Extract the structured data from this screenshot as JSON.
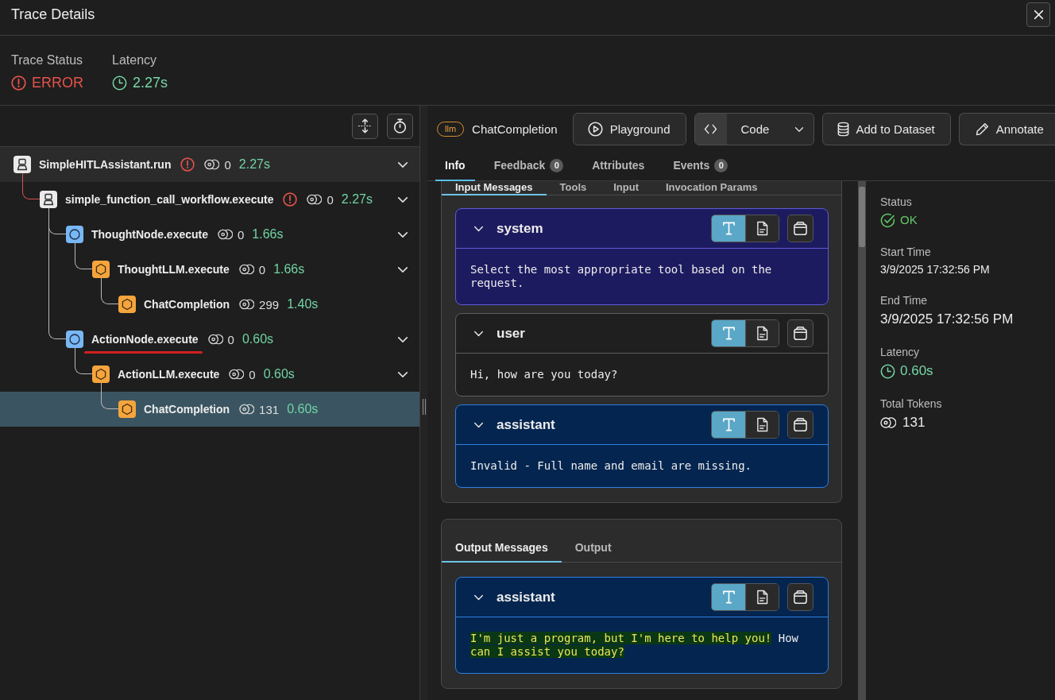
{
  "dialog": {
    "title": "Trace Details"
  },
  "summary": [
    {
      "label": "Trace Status",
      "value": "ERROR",
      "kind": "status_error"
    },
    {
      "label": "Latency",
      "value": "2.27s",
      "kind": "latency"
    }
  ],
  "tree": {
    "nodes": [
      {
        "name": "SimpleHITLAssistant.run",
        "kind": "agent",
        "error": true,
        "tokens": "0",
        "latency": "2.27s",
        "expanded": true,
        "selected": false,
        "underlined": false,
        "children": [
          {
            "name": "simple_function_call_workflow.execute",
            "kind": "agent",
            "error": true,
            "tokens": "0",
            "latency": "2.27s",
            "expanded": true,
            "selected": false,
            "underlined": false,
            "children": [
              {
                "name": "ThoughtNode.execute",
                "kind": "node",
                "error": false,
                "tokens": "0",
                "latency": "1.66s",
                "expanded": true,
                "selected": false,
                "underlined": false,
                "children": [
                  {
                    "name": "ThoughtLLM.execute",
                    "kind": "llm",
                    "error": false,
                    "tokens": "0",
                    "latency": "1.66s",
                    "expanded": true,
                    "selected": false,
                    "underlined": false,
                    "children": [
                      {
                        "name": "ChatCompletion",
                        "kind": "llm",
                        "error": false,
                        "tokens": "299",
                        "latency": "1.40s",
                        "expanded": false,
                        "selected": false,
                        "underlined": false
                      }
                    ]
                  }
                ]
              },
              {
                "name": "ActionNode.execute",
                "kind": "node",
                "error": false,
                "tokens": "0",
                "latency": "0.60s",
                "expanded": true,
                "selected": false,
                "underlined": true,
                "children": [
                  {
                    "name": "ActionLLM.execute",
                    "kind": "llm",
                    "error": false,
                    "tokens": "0",
                    "latency": "0.60s",
                    "expanded": true,
                    "selected": false,
                    "underlined": false,
                    "children": [
                      {
                        "name": "ChatCompletion",
                        "kind": "llm",
                        "error": false,
                        "tokens": "131",
                        "latency": "0.60s",
                        "expanded": false,
                        "selected": true,
                        "underlined": false
                      }
                    ]
                  }
                ]
              }
            ]
          }
        ]
      }
    ]
  },
  "span": {
    "badge": "llm",
    "name": "ChatCompletion",
    "actions": [
      {
        "label": "Playground",
        "kind": "play"
      },
      {
        "label": "Code",
        "kind": "code_select"
      },
      {
        "label": "Add to Dataset",
        "kind": "dataset"
      },
      {
        "label": "Annotate",
        "kind": "annotate"
      }
    ],
    "tabs": [
      {
        "label": "Info",
        "selected": true
      },
      {
        "label": "Feedback",
        "count": "0",
        "selected": false
      },
      {
        "label": "Attributes",
        "selected": false
      },
      {
        "label": "Events",
        "count": "0",
        "selected": false
      }
    ]
  },
  "input_section": {
    "tabs": [
      {
        "label": "Input Messages",
        "selected": true
      },
      {
        "label": "Tools",
        "selected": false
      },
      {
        "label": "Input",
        "selected": false
      },
      {
        "label": "Invocation Params",
        "selected": false
      }
    ],
    "messages": [
      {
        "kind": "system",
        "role": "system",
        "expanded": true,
        "views": [
          {
            "kind": "text",
            "selected": true
          },
          {
            "kind": "document",
            "selected": false
          }
        ],
        "segments": [
          {
            "text": "Select the most appropriate tool based on the request.",
            "highlighted": false
          }
        ]
      },
      {
        "kind": "user",
        "role": "user",
        "expanded": true,
        "views": [
          {
            "kind": "text",
            "selected": true
          },
          {
            "kind": "document",
            "selected": false
          }
        ],
        "segments": [
          {
            "text": "Hi, how are you today?",
            "highlighted": false
          }
        ]
      },
      {
        "kind": "assistant",
        "role": "assistant",
        "expanded": true,
        "views": [
          {
            "kind": "text",
            "selected": true
          },
          {
            "kind": "document",
            "selected": false
          }
        ],
        "segments": [
          {
            "text": "Invalid - Full name and email are missing.",
            "highlighted": false
          }
        ]
      }
    ]
  },
  "output_section": {
    "tabs": [
      {
        "label": "Output Messages",
        "selected": true
      },
      {
        "label": "Output",
        "selected": false
      }
    ],
    "messages": [
      {
        "kind": "assistant",
        "role": "assistant",
        "expanded": true,
        "views": [
          {
            "kind": "text",
            "selected": true
          },
          {
            "kind": "document",
            "selected": false
          }
        ],
        "segments": [
          {
            "text": "I'm just a program, but I'm here to help you!",
            "highlighted": true
          },
          {
            "text": " How ",
            "highlighted": false
          },
          {
            "text": "can I assist you today?",
            "highlighted": true
          }
        ]
      }
    ]
  },
  "details": [
    {
      "label": "Status",
      "value": "OK",
      "kind": "status_ok"
    },
    {
      "label": "Start Time",
      "value": "3/9/2025 17:32:56 PM",
      "kind": "time"
    },
    {
      "label": "End Time",
      "value": "3/9/2025 17:32:56 PM",
      "kind": "time_large"
    },
    {
      "label": "Latency",
      "value": "0.60s",
      "kind": "latency"
    },
    {
      "label": "Total Tokens",
      "value": "131",
      "kind": "tokens"
    }
  ]
}
